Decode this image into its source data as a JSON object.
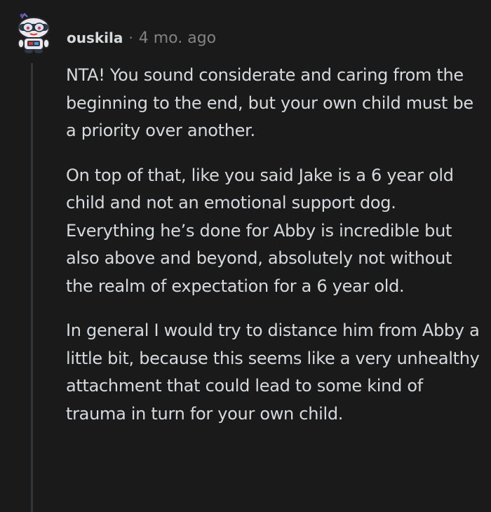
{
  "comment": {
    "author": "ouskila",
    "separator": "·",
    "timestamp": "4 mo. ago",
    "avatar_icon": "snoo-avatar-icon",
    "paragraphs": [
      "NTA! You sound considerate and caring from the beginning to the end, but your own child must be a priority over another.",
      "On top of that, like you said Jake is a 6 year old child and not an emotional support dog. Everything he’s done for Abby is incredible but also above and beyond, absolutely not without the realm of expectation for a 6 year old.",
      "In general I would try to distance him from Abby a little bit, because this seems like a very unhealthy attachment that could lead to some kind of trauma in turn for your own child."
    ]
  },
  "colors": {
    "background": "#1a1a1b",
    "text": "#d7dadc",
    "meta": "#818384",
    "thread_line": "#343536"
  }
}
